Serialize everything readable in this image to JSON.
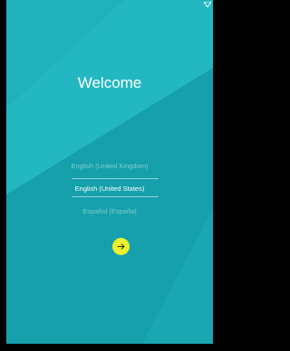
{
  "welcome": {
    "title": "Welcome"
  },
  "languages": {
    "items": [
      {
        "label": "English (United Kingdom)",
        "state": "dim"
      },
      {
        "label": "English (United States)",
        "state": "selected"
      },
      {
        "label": "Español (España)",
        "state": "dim"
      }
    ]
  },
  "next_button": {
    "icon": "arrow-right-icon"
  },
  "colors": {
    "background": "#1fb3bd",
    "accent": "#eef12b",
    "text": "#ffffff"
  }
}
